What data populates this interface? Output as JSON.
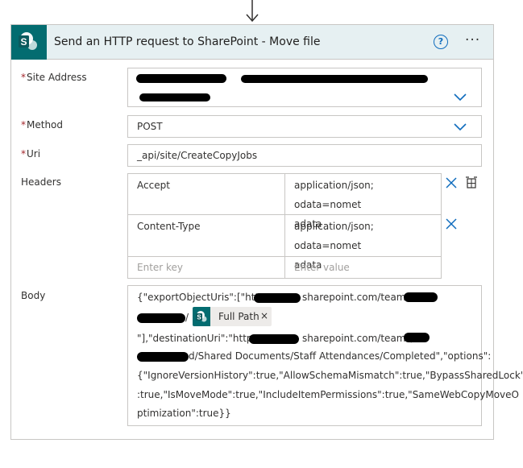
{
  "action": {
    "title": "Send an HTTP request to SharePoint - Move file",
    "help": "?",
    "more": "···",
    "icon": "sharepoint-icon"
  },
  "fields": {
    "site_address": {
      "label": "Site Address",
      "required": true
    },
    "method": {
      "label": "Method",
      "required": true,
      "value": "POST"
    },
    "uri": {
      "label": "Uri",
      "required": true,
      "value": "_api/site/CreateCopyJobs"
    },
    "headers": {
      "label": "Headers",
      "rows": [
        {
          "key": "Accept",
          "value_line1": "application/json; odata=nomet",
          "value_line2": "adata"
        },
        {
          "key": "Content-Type",
          "value_line1": "application/json; odata=nomet",
          "value_line2": "adata"
        }
      ],
      "key_placeholder": "Enter key",
      "value_placeholder": "Enter value"
    },
    "body": {
      "label": "Body",
      "line1_a": "{\"exportObjectUris\":[\"https:/",
      "line1_b": "sharepoint.com/teams/",
      "line2_slash": "/",
      "token_label": "Full Path",
      "token_close": "×",
      "line3_a": "\"],\"destinationUri\":\"https:/",
      "line3_b": "sharepoint.com/teams/",
      "line4": "d/Shared Documents/Staff Attendances/Completed\",\"options\":",
      "line5": "{\"IgnoreVersionHistory\":true,\"AllowSchemaMismatch\":true,\"BypassSharedLock\"",
      "line6": ":true,\"IsMoveMode\":true,\"IncludeItemPermissions\":true,\"SameWebCopyMoveO",
      "line7": "ptimization\":true}}"
    }
  },
  "colors": {
    "header_bg": "#e6f0f2",
    "sharepoint_teal": "#036c70",
    "accent_blue": "#0f6cbd",
    "required_red": "#a4262c"
  }
}
